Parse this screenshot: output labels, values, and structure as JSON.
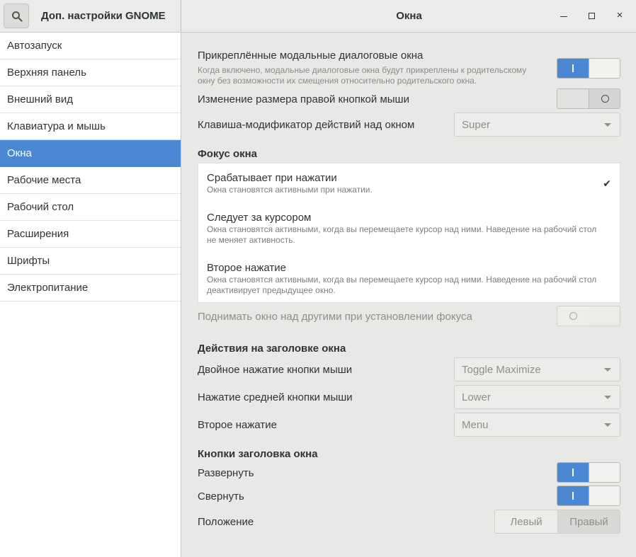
{
  "header": {
    "app_title": "Доп. настройки GNOME",
    "window_title": "Окна",
    "minimize": "–",
    "maximize": "☐",
    "close": "×"
  },
  "sidebar": {
    "items": [
      {
        "label": "Автозапуск"
      },
      {
        "label": "Верхняя панель"
      },
      {
        "label": "Внешний вид"
      },
      {
        "label": "Клавиатура и мышь"
      },
      {
        "label": "Окна",
        "selected": true
      },
      {
        "label": "Рабочие места"
      },
      {
        "label": "Рабочий стол"
      },
      {
        "label": "Расширения"
      },
      {
        "label": "Шрифты"
      },
      {
        "label": "Электропитание"
      }
    ]
  },
  "main": {
    "attach_modal": {
      "label": "Прикреплённые модальные диалоговые окна",
      "desc_line1": "Когда включено, модальные диалоговые окна будут прикреплены к родительскому",
      "desc_line2": "окну без возможности их смещения относительно родительского окна.",
      "state": "on"
    },
    "resize_right_click": {
      "label": "Изменение размера правой кнопкой мыши",
      "state": "off"
    },
    "modifier_key": {
      "label": "Клавиша-модификатор действий над окном",
      "value": "Super"
    },
    "focus_section": "Фокус окна",
    "focus_options": [
      {
        "title": "Срабатывает при нажатии",
        "desc_line1": "Окна становятся активными при нажатии.",
        "desc_line2": "",
        "selected": true
      },
      {
        "title": "Следует за курсором",
        "desc_line1": "Окна становятся активными, когда вы перемещаете курсор над ними. Наведение на рабочий стол",
        "desc_line2": "не меняет активность.",
        "selected": false
      },
      {
        "title": "Второе нажатие",
        "desc_line1": "Окна становятся активными, когда вы перемещаете курсор над ними. Наведение на рабочий стол",
        "desc_line2": "деактивирует предыдущее окно.",
        "selected": false
      }
    ],
    "check_mark": "✔",
    "raise_on_focus": {
      "label": "Поднимать окно над другими при установлении фокуса",
      "state": "off",
      "disabled": true
    },
    "titlebar_actions_section": "Действия на заголовке окна",
    "double_click": {
      "label": "Двойное нажатие кнопки мыши",
      "value": "Toggle Maximize"
    },
    "middle_click": {
      "label": "Нажатие средней кнопки мыши",
      "value": "Lower"
    },
    "secondary_click": {
      "label": "Второе нажатие",
      "value": "Menu"
    },
    "titlebar_buttons_section": "Кнопки заголовка окна",
    "maximize": {
      "label": "Развернуть",
      "state": "on"
    },
    "minimize": {
      "label": "Свернуть",
      "state": "on"
    },
    "placement": {
      "label": "Положение",
      "left": "Левый",
      "right": "Правый",
      "selected": "right"
    }
  },
  "colors": {
    "accent": "#4a88d4",
    "sidebar_bg": "#ffffff",
    "main_bg": "#e8e8e7"
  },
  "icons": {
    "search": "search-icon",
    "check": "check-icon",
    "dropdown": "chevron-down-icon"
  }
}
